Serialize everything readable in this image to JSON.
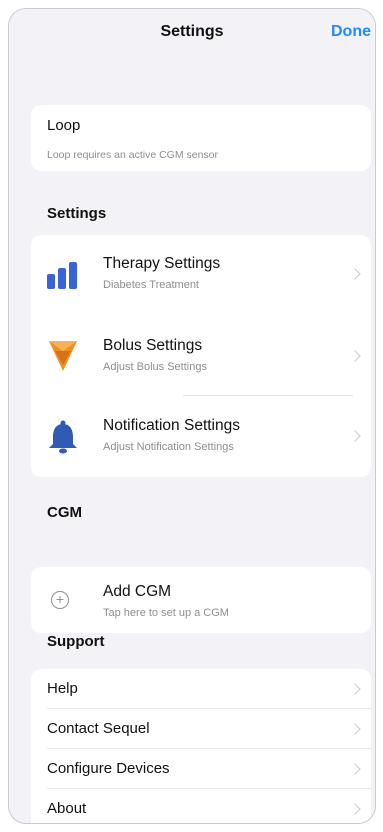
{
  "nav": {
    "title": "Settings",
    "done_label": "Done"
  },
  "loop": {
    "label": "Loop",
    "note": "Loop requires an active CGM sensor"
  },
  "settings": {
    "section_title": "Settings",
    "items": [
      {
        "title": "Therapy Settings",
        "subtitle": "Diabetes Treatment",
        "icon": "therapy-bars-icon"
      },
      {
        "title": "Bolus Settings",
        "subtitle": "Adjust Bolus Settings",
        "icon": "bolus-icon"
      },
      {
        "title": "Notification Settings",
        "subtitle": "Adjust Notification Settings",
        "icon": "bell-icon"
      }
    ]
  },
  "cgm": {
    "section_title": "CGM",
    "title": "Add CGM",
    "subtitle": "Tap here to set up a CGM"
  },
  "support": {
    "section_title": "Support",
    "items": [
      {
        "label": "Help"
      },
      {
        "label": "Contact Sequel"
      },
      {
        "label": "Configure Devices"
      },
      {
        "label": "About"
      }
    ]
  },
  "colors": {
    "accent": "#1f8cff",
    "therapy_icon": "#3a63d8",
    "bolus_orange": "#f0901e",
    "bell_blue": "#2f5bb4",
    "background": "#f2f2f7"
  }
}
